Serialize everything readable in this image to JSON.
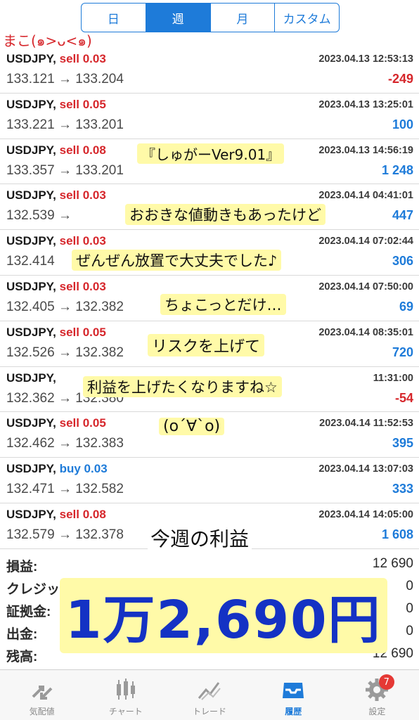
{
  "segment": {
    "day": "日",
    "week": "週",
    "month": "月",
    "custom": "カスタム"
  },
  "trades": [
    {
      "symbol": "USDJPY,",
      "side": "sell",
      "side_text": "sell 0.03",
      "time": "2023.04.13 12:53:13",
      "prices": "133.121 → 133.204",
      "pl": "-249",
      "pl_sign": "neg"
    },
    {
      "symbol": "USDJPY,",
      "side": "sell",
      "side_text": "sell 0.05",
      "time": "2023.04.13 13:25:01",
      "prices": "133.221 → 133.201",
      "pl": "100",
      "pl_sign": "pos"
    },
    {
      "symbol": "USDJPY,",
      "side": "sell",
      "side_text": "sell 0.08",
      "time": "2023.04.13 14:56:19",
      "prices": "133.357 → 133.201",
      "pl": "1 248",
      "pl_sign": "pos"
    },
    {
      "symbol": "USDJPY,",
      "side": "sell",
      "side_text": "sell 0.03",
      "time": "2023.04.14 04:41:01",
      "prices": "132.539 →",
      "pl": "447",
      "pl_sign": "pos"
    },
    {
      "symbol": "USDJPY,",
      "side": "sell",
      "side_text": "sell 0.03",
      "time": "2023.04.14 07:02:44",
      "prices": "132.414",
      "pl": "306",
      "pl_sign": "pos"
    },
    {
      "symbol": "USDJPY,",
      "side": "sell",
      "side_text": "sell 0.03",
      "time": "2023.04.14 07:50:00",
      "prices": "132.405 → 132.382",
      "pl": "69",
      "pl_sign": "pos"
    },
    {
      "symbol": "USDJPY,",
      "side": "sell",
      "side_text": "sell 0.05",
      "time": "2023.04.14 08:35:01",
      "prices": "132.526 → 132.382",
      "pl": "720",
      "pl_sign": "pos"
    },
    {
      "symbol": "USDJPY,",
      "side": "sell",
      "side_text": "",
      "time": "11:31:00",
      "prices": "132.362 → 132.380",
      "pl": "-54",
      "pl_sign": "neg"
    },
    {
      "symbol": "USDJPY,",
      "side": "sell",
      "side_text": "sell 0.05",
      "time": "2023.04.14 11:52:53",
      "prices": "132.462 → 132.383",
      "pl": "395",
      "pl_sign": "pos"
    },
    {
      "symbol": "USDJPY,",
      "side": "buy",
      "side_text": "buy 0.03",
      "time": "2023.04.14 13:07:03",
      "prices": "132.471 → 132.582",
      "pl": "333",
      "pl_sign": "pos"
    },
    {
      "symbol": "USDJPY,",
      "side": "sell",
      "side_text": "sell 0.08",
      "time": "2023.04.14 14:05:00",
      "prices": "132.579 → 132.378",
      "pl": "1 608",
      "pl_sign": "pos"
    }
  ],
  "summary": [
    {
      "label": "損益:",
      "value": "12 690"
    },
    {
      "label": "クレジット:",
      "value": "0"
    },
    {
      "label": "証拠金:",
      "value": "0"
    },
    {
      "label": "出金:",
      "value": "0"
    },
    {
      "label": "残高:",
      "value": "12 690"
    }
  ],
  "tabs": [
    {
      "label": "気配値",
      "icon": "quotes-icon"
    },
    {
      "label": "チャート",
      "icon": "chart-icon"
    },
    {
      "label": "トレード",
      "icon": "trade-icon"
    },
    {
      "label": "履歴",
      "icon": "history-icon",
      "active": true
    },
    {
      "label": "設定",
      "icon": "settings-icon",
      "badge": "7"
    }
  ],
  "handwriting": {
    "corner": "まこ(๑>ᴗ<๑)",
    "version": "『しゅがーVer9.01』",
    "line1": "おおきな値動きもあったけど",
    "line2": "ぜんぜん放置で大丈夫でした♪",
    "line3": "ちょこっとだけ…",
    "line4": "リスクを上げて",
    "line5": "利益を上げたくなりますね☆",
    "line6": "(o´∀`o)",
    "weekly": "今週の利益",
    "total": "1万2,690円"
  },
  "colors": {
    "accent": "#1e7bd9",
    "loss": "#d6262b",
    "highlight": "#fffaa8",
    "total_ink": "#1432c4"
  }
}
